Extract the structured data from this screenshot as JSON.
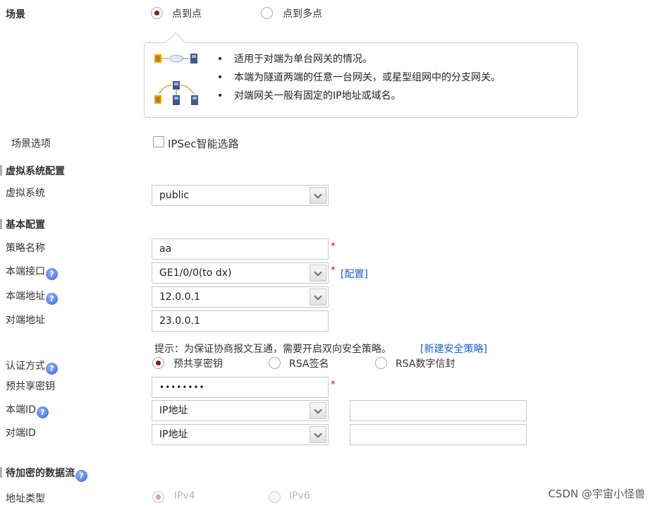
{
  "scenario": {
    "label": "场景",
    "options": [
      {
        "label": "点到点",
        "selected": true
      },
      {
        "label": "点到多点",
        "selected": false
      }
    ],
    "info_bullets": [
      "适用于对端为单台网关的情况。",
      "本端为隧道两端的任意一台网关，或星型组网中的分支网关。",
      "对端网关一般有固定的IP地址或域名。"
    ]
  },
  "scenario_options": {
    "label": "场景选项",
    "checkbox_label": "IPSec智能选路",
    "checked": false
  },
  "vsys_section": {
    "title": "虚拟系统配置",
    "vsys_label": "虚拟系统",
    "vsys_value": "public"
  },
  "basic_section": {
    "title": "基本配置",
    "policy_name_label": "策略名称",
    "policy_name_value": "aa",
    "local_interface_label": "本端接口",
    "local_interface_value": "GE1/0/0(to dx)",
    "config_link": "[配置]",
    "local_address_label": "本端地址",
    "local_address_value": "12.0.0.1",
    "peer_address_label": "对端地址",
    "peer_address_value": "23.0.0.1",
    "tip_text": "提示：为保证协商报文互通，需要开启双向安全策略。",
    "new_policy_link": "[新建安全策略]",
    "auth_label": "认证方式",
    "auth_options": [
      {
        "label": "预共享密钥",
        "selected": true
      },
      {
        "label": "RSA签名",
        "selected": false
      },
      {
        "label": "RSA数字信封",
        "selected": false
      }
    ],
    "psk_label": "预共享密钥",
    "psk_value": "••••••••",
    "local_id_label": "本端ID",
    "local_id_type": "IP地址",
    "local_id_value": "",
    "peer_id_label": "对端ID",
    "peer_id_type": "IP地址",
    "peer_id_value": ""
  },
  "flow_section": {
    "title": "待加密的数据流",
    "addr_type_label": "地址类型",
    "addr_type_options": [
      {
        "label": "IPv4",
        "selected": true
      },
      {
        "label": "IPv6",
        "selected": false
      }
    ]
  },
  "help_glyph": "?",
  "required_mark": "*",
  "watermark": "CSDN @宇宙小怪兽",
  "colors": {
    "radio_selected": "#8b1a1a",
    "link": "#1f5fc7",
    "required": "#d0021b"
  }
}
